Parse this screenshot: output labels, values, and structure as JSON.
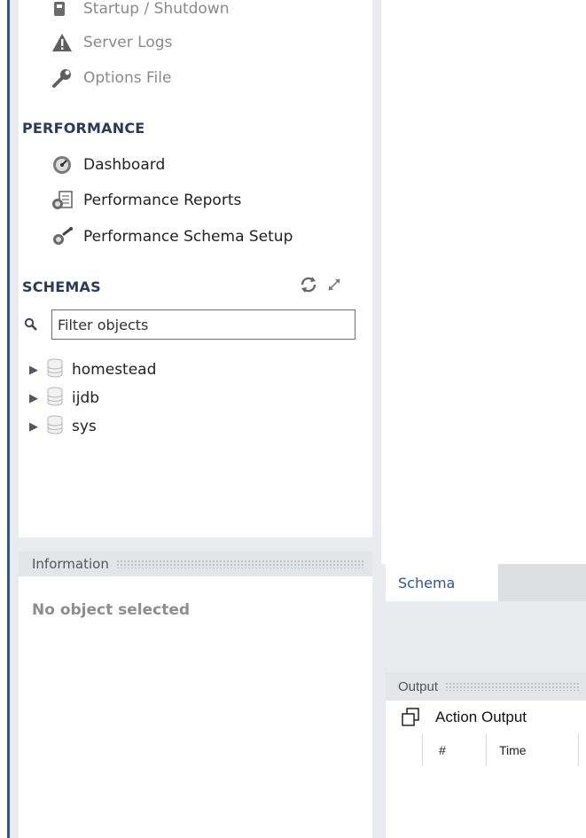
{
  "management": {
    "items": [
      {
        "label": "Startup / Shutdown",
        "icon": "startup-icon"
      },
      {
        "label": "Server Logs",
        "icon": "warning-icon"
      },
      {
        "label": "Options File",
        "icon": "wrench-icon"
      }
    ]
  },
  "performance": {
    "title": "PERFORMANCE",
    "items": [
      {
        "label": "Dashboard",
        "icon": "dashboard-icon"
      },
      {
        "label": "Performance Reports",
        "icon": "reports-icon"
      },
      {
        "label": "Performance Schema Setup",
        "icon": "schema-setup-icon"
      }
    ]
  },
  "schemas": {
    "title": "SCHEMAS",
    "filter_placeholder": "Filter objects",
    "items": [
      {
        "name": "homestead"
      },
      {
        "name": "ijdb"
      },
      {
        "name": "sys"
      }
    ]
  },
  "information": {
    "title": "Information",
    "message": "No object selected"
  },
  "schema_tab": {
    "label": "Schema"
  },
  "output": {
    "title": "Output",
    "action_label": "Action Output",
    "columns": [
      "#",
      "Time"
    ]
  },
  "colors": {
    "accent": "#2f5596",
    "panel_bg": "#e9ebef"
  }
}
